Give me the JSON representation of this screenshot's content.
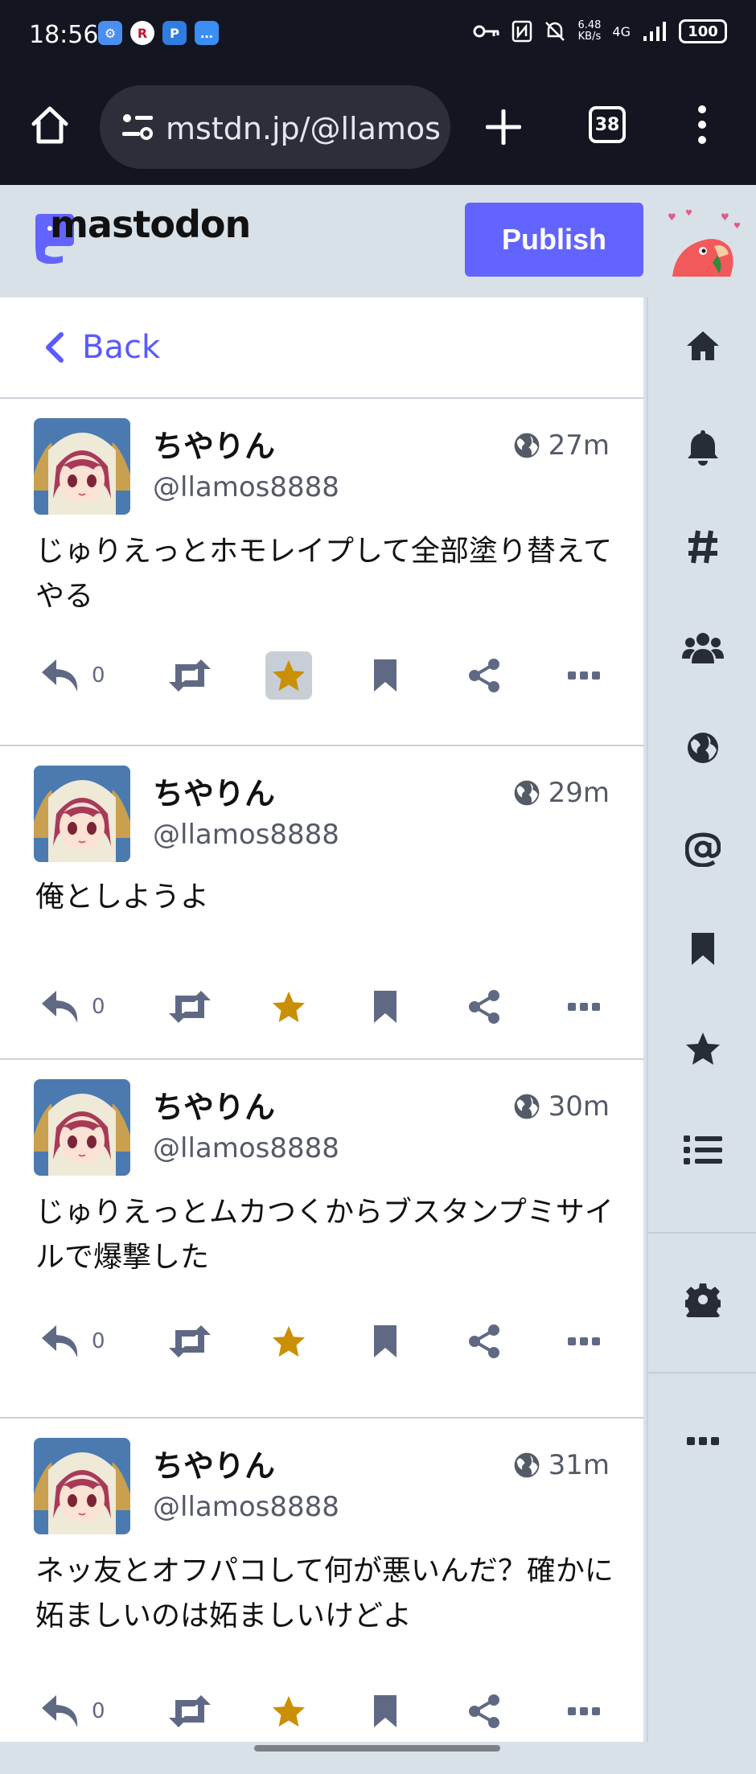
{
  "status_bar": {
    "time": "18:56",
    "speed_top": "6.48",
    "speed_bottom": "KB/s",
    "network": "4G",
    "battery": "100"
  },
  "browser": {
    "url": "mstdn.jp/@llamos",
    "tab_count": "38"
  },
  "header": {
    "logo": "mastodon",
    "publish_label": "Publish"
  },
  "back_label": "Back",
  "posts": [
    {
      "display_name": "ちやりん",
      "acct": "@llamos8888",
      "time": "27m",
      "text": "じゅりえっとホモレイプして全部塗り替えてやる",
      "replies": "0",
      "fav_active": true
    },
    {
      "display_name": "ちやりん",
      "acct": "@llamos8888",
      "time": "29m",
      "text": "俺としようよ",
      "replies": "0",
      "fav_active": false
    },
    {
      "display_name": "ちやりん",
      "acct": "@llamos8888",
      "time": "30m",
      "text": "じゅりえっとムカつくからブスタンプミサイルで爆撃した",
      "replies": "0",
      "fav_active": false
    },
    {
      "display_name": "ちやりん",
      "acct": "@llamos8888",
      "time": "31m",
      "text": "ネッ友とオフパコして何が悪いんだ？確かに妬ましいのは妬ましいけどよ",
      "replies": "0",
      "fav_active": false
    }
  ],
  "colors": {
    "accent": "#6364ff",
    "link": "#595aff",
    "star": "#ca8f04",
    "icon": "#606984",
    "nav_icon": "#282c37"
  }
}
